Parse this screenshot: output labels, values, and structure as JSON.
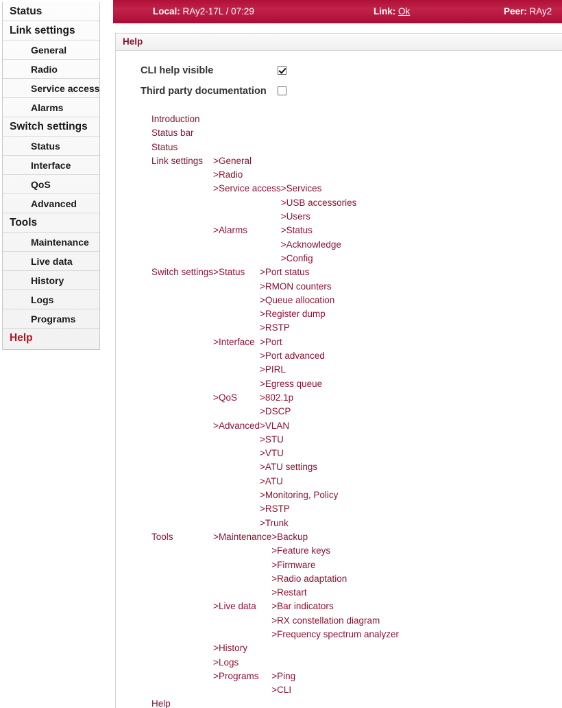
{
  "sidebar": {
    "items": [
      {
        "label": "Status",
        "level": 0,
        "active": false
      },
      {
        "label": "Link settings",
        "level": 0,
        "active": false
      },
      {
        "label": "General",
        "level": 1,
        "active": false
      },
      {
        "label": "Radio",
        "level": 1,
        "active": false
      },
      {
        "label": "Service access",
        "level": 1,
        "active": false
      },
      {
        "label": "Alarms",
        "level": 1,
        "active": false
      },
      {
        "label": "Switch settings",
        "level": 0,
        "active": false
      },
      {
        "label": "Status",
        "level": 1,
        "active": false
      },
      {
        "label": "Interface",
        "level": 1,
        "active": false
      },
      {
        "label": "QoS",
        "level": 1,
        "active": false
      },
      {
        "label": "Advanced",
        "level": 1,
        "active": false
      },
      {
        "label": "Tools",
        "level": 0,
        "active": false
      },
      {
        "label": "Maintenance",
        "level": 1,
        "active": false
      },
      {
        "label": "Live data",
        "level": 1,
        "active": false
      },
      {
        "label": "History",
        "level": 1,
        "active": false
      },
      {
        "label": "Logs",
        "level": 1,
        "active": false
      },
      {
        "label": "Programs",
        "level": 1,
        "active": false
      },
      {
        "label": "Help",
        "level": 0,
        "active": true
      }
    ]
  },
  "statusbar": {
    "local_key": "Local:",
    "local_value": "RAy2-17L / 07:29",
    "link_key": "Link:",
    "link_value": "Ok",
    "peer_key": "Peer:",
    "peer_value": "RAy2"
  },
  "panel": {
    "title": "Help"
  },
  "options": [
    {
      "label": "CLI help visible",
      "checked": true
    },
    {
      "label": "Third party documentation",
      "checked": false
    }
  ],
  "tree": {
    "arrow": ">",
    "rows": [
      {
        "c1": "Introduction"
      },
      {
        "c1": "Status bar"
      },
      {
        "c1": "Status"
      },
      {
        "c1": "Link settings",
        "c2": "General"
      },
      {
        "c2": "Radio"
      },
      {
        "c2": "Service access",
        "c3": "Services"
      },
      {
        "c3": "USB accessories"
      },
      {
        "c3": "Users"
      },
      {
        "c2": "Alarms",
        "c3": "Status"
      },
      {
        "c3": "Acknowledge"
      },
      {
        "c3": "Config"
      },
      {
        "c1": "Switch settings",
        "c2": "Status",
        "c3": "Port status"
      },
      {
        "c3": "RMON counters"
      },
      {
        "c3": "Queue allocation"
      },
      {
        "c3": "Register dump"
      },
      {
        "c3": "RSTP"
      },
      {
        "c2": "Interface",
        "c3": "Port"
      },
      {
        "c3": "Port advanced"
      },
      {
        "c3": "PIRL"
      },
      {
        "c3": "Egress queue"
      },
      {
        "c2": "QoS",
        "c3": "802.1p"
      },
      {
        "c3": "DSCP"
      },
      {
        "c2": "Advanced",
        "c3": "VLAN"
      },
      {
        "c3": "STU"
      },
      {
        "c3": "VTU"
      },
      {
        "c3": "ATU settings"
      },
      {
        "c3": "ATU"
      },
      {
        "c3": "Monitoring, Policy"
      },
      {
        "c3": "RSTP"
      },
      {
        "c3": "Trunk"
      },
      {
        "c1": "Tools",
        "c2": "Maintenance",
        "c3": "Backup"
      },
      {
        "c3": "Feature keys"
      },
      {
        "c3": "Firmware"
      },
      {
        "c3": "Radio adaptation"
      },
      {
        "c3": "Restart"
      },
      {
        "c2": "Live data",
        "c3": "Bar indicators"
      },
      {
        "c3": "RX constellation diagram"
      },
      {
        "c3": "Frequency spectrum analyzer"
      },
      {
        "c2": "History"
      },
      {
        "c2": "Logs"
      },
      {
        "c2": "Programs",
        "c3": "Ping"
      },
      {
        "c3": "CLI"
      },
      {
        "c1": "Help"
      }
    ],
    "groups": {
      "link_settings": {
        "root": "Link settings",
        "branches": [
          {
            "name": "General",
            "children": []
          },
          {
            "name": "Radio",
            "children": []
          },
          {
            "name": "Service access",
            "children": [
              "Services",
              "USB accessories",
              "Users"
            ]
          },
          {
            "name": "Alarms",
            "children": [
              "Status",
              "Acknowledge",
              "Config"
            ]
          }
        ]
      },
      "switch_settings": {
        "root": "Switch settings",
        "branches": [
          {
            "name": "Status",
            "children": [
              "Port status",
              "RMON counters",
              "Queue allocation",
              "Register dump",
              "RSTP"
            ]
          },
          {
            "name": "Interface",
            "children": [
              "Port",
              "Port advanced",
              "PIRL",
              "Egress queue"
            ]
          },
          {
            "name": "QoS",
            "children": [
              "802.1p",
              "DSCP"
            ]
          },
          {
            "name": "Advanced",
            "children": [
              "VLAN",
              "STU",
              "VTU",
              "ATU settings",
              "ATU",
              "Monitoring, Policy",
              "RSTP",
              "Trunk"
            ]
          }
        ]
      },
      "tools": {
        "root": "Tools",
        "branches": [
          {
            "name": "Maintenance",
            "children": [
              "Backup",
              "Feature keys",
              "Firmware",
              "Radio adaptation",
              "Restart"
            ]
          },
          {
            "name": "Live data",
            "children": [
              "Bar indicators",
              "RX constellation diagram",
              "Frequency spectrum analyzer"
            ]
          },
          {
            "name": "History",
            "children": []
          },
          {
            "name": "Logs",
            "children": []
          },
          {
            "name": "Programs",
            "children": [
              "Ping",
              "CLI"
            ]
          }
        ]
      }
    },
    "top_level": [
      "Introduction",
      "Status bar",
      "Status"
    ],
    "bottom_level": [
      "Help"
    ]
  },
  "colors": {
    "brand_red": "#8c1230",
    "statusbar_red": "#b81a44",
    "sidebar_help_red": "#b5121b",
    "link_red": "#8c1230",
    "border_gray": "#d3d3d3"
  }
}
